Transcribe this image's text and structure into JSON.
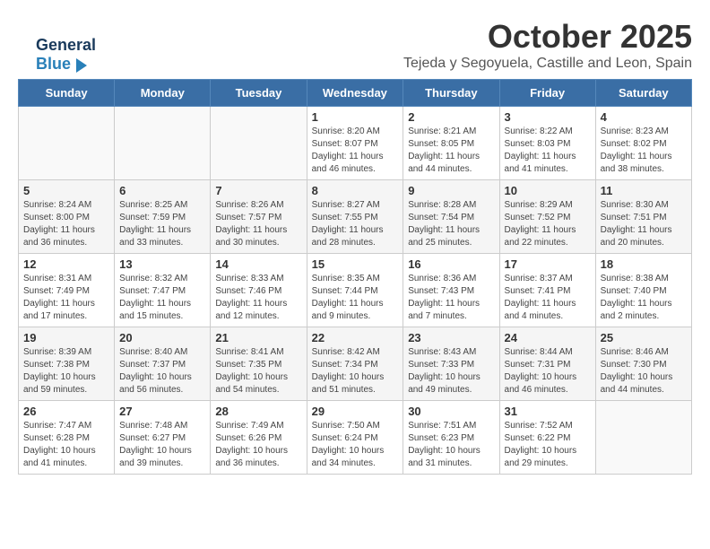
{
  "header": {
    "logo_general": "General",
    "logo_blue": "Blue",
    "month": "October 2025",
    "location": "Tejeda y Segoyuela, Castille and Leon, Spain"
  },
  "weekdays": [
    "Sunday",
    "Monday",
    "Tuesday",
    "Wednesday",
    "Thursday",
    "Friday",
    "Saturday"
  ],
  "weeks": [
    [
      {
        "day": "",
        "info": ""
      },
      {
        "day": "",
        "info": ""
      },
      {
        "day": "",
        "info": ""
      },
      {
        "day": "1",
        "info": "Sunrise: 8:20 AM\nSunset: 8:07 PM\nDaylight: 11 hours and 46 minutes."
      },
      {
        "day": "2",
        "info": "Sunrise: 8:21 AM\nSunset: 8:05 PM\nDaylight: 11 hours and 44 minutes."
      },
      {
        "day": "3",
        "info": "Sunrise: 8:22 AM\nSunset: 8:03 PM\nDaylight: 11 hours and 41 minutes."
      },
      {
        "day": "4",
        "info": "Sunrise: 8:23 AM\nSunset: 8:02 PM\nDaylight: 11 hours and 38 minutes."
      }
    ],
    [
      {
        "day": "5",
        "info": "Sunrise: 8:24 AM\nSunset: 8:00 PM\nDaylight: 11 hours and 36 minutes."
      },
      {
        "day": "6",
        "info": "Sunrise: 8:25 AM\nSunset: 7:59 PM\nDaylight: 11 hours and 33 minutes."
      },
      {
        "day": "7",
        "info": "Sunrise: 8:26 AM\nSunset: 7:57 PM\nDaylight: 11 hours and 30 minutes."
      },
      {
        "day": "8",
        "info": "Sunrise: 8:27 AM\nSunset: 7:55 PM\nDaylight: 11 hours and 28 minutes."
      },
      {
        "day": "9",
        "info": "Sunrise: 8:28 AM\nSunset: 7:54 PM\nDaylight: 11 hours and 25 minutes."
      },
      {
        "day": "10",
        "info": "Sunrise: 8:29 AM\nSunset: 7:52 PM\nDaylight: 11 hours and 22 minutes."
      },
      {
        "day": "11",
        "info": "Sunrise: 8:30 AM\nSunset: 7:51 PM\nDaylight: 11 hours and 20 minutes."
      }
    ],
    [
      {
        "day": "12",
        "info": "Sunrise: 8:31 AM\nSunset: 7:49 PM\nDaylight: 11 hours and 17 minutes."
      },
      {
        "day": "13",
        "info": "Sunrise: 8:32 AM\nSunset: 7:47 PM\nDaylight: 11 hours and 15 minutes."
      },
      {
        "day": "14",
        "info": "Sunrise: 8:33 AM\nSunset: 7:46 PM\nDaylight: 11 hours and 12 minutes."
      },
      {
        "day": "15",
        "info": "Sunrise: 8:35 AM\nSunset: 7:44 PM\nDaylight: 11 hours and 9 minutes."
      },
      {
        "day": "16",
        "info": "Sunrise: 8:36 AM\nSunset: 7:43 PM\nDaylight: 11 hours and 7 minutes."
      },
      {
        "day": "17",
        "info": "Sunrise: 8:37 AM\nSunset: 7:41 PM\nDaylight: 11 hours and 4 minutes."
      },
      {
        "day": "18",
        "info": "Sunrise: 8:38 AM\nSunset: 7:40 PM\nDaylight: 11 hours and 2 minutes."
      }
    ],
    [
      {
        "day": "19",
        "info": "Sunrise: 8:39 AM\nSunset: 7:38 PM\nDaylight: 10 hours and 59 minutes."
      },
      {
        "day": "20",
        "info": "Sunrise: 8:40 AM\nSunset: 7:37 PM\nDaylight: 10 hours and 56 minutes."
      },
      {
        "day": "21",
        "info": "Sunrise: 8:41 AM\nSunset: 7:35 PM\nDaylight: 10 hours and 54 minutes."
      },
      {
        "day": "22",
        "info": "Sunrise: 8:42 AM\nSunset: 7:34 PM\nDaylight: 10 hours and 51 minutes."
      },
      {
        "day": "23",
        "info": "Sunrise: 8:43 AM\nSunset: 7:33 PM\nDaylight: 10 hours and 49 minutes."
      },
      {
        "day": "24",
        "info": "Sunrise: 8:44 AM\nSunset: 7:31 PM\nDaylight: 10 hours and 46 minutes."
      },
      {
        "day": "25",
        "info": "Sunrise: 8:46 AM\nSunset: 7:30 PM\nDaylight: 10 hours and 44 minutes."
      }
    ],
    [
      {
        "day": "26",
        "info": "Sunrise: 7:47 AM\nSunset: 6:28 PM\nDaylight: 10 hours and 41 minutes."
      },
      {
        "day": "27",
        "info": "Sunrise: 7:48 AM\nSunset: 6:27 PM\nDaylight: 10 hours and 39 minutes."
      },
      {
        "day": "28",
        "info": "Sunrise: 7:49 AM\nSunset: 6:26 PM\nDaylight: 10 hours and 36 minutes."
      },
      {
        "day": "29",
        "info": "Sunrise: 7:50 AM\nSunset: 6:24 PM\nDaylight: 10 hours and 34 minutes."
      },
      {
        "day": "30",
        "info": "Sunrise: 7:51 AM\nSunset: 6:23 PM\nDaylight: 10 hours and 31 minutes."
      },
      {
        "day": "31",
        "info": "Sunrise: 7:52 AM\nSunset: 6:22 PM\nDaylight: 10 hours and 29 minutes."
      },
      {
        "day": "",
        "info": ""
      }
    ]
  ]
}
